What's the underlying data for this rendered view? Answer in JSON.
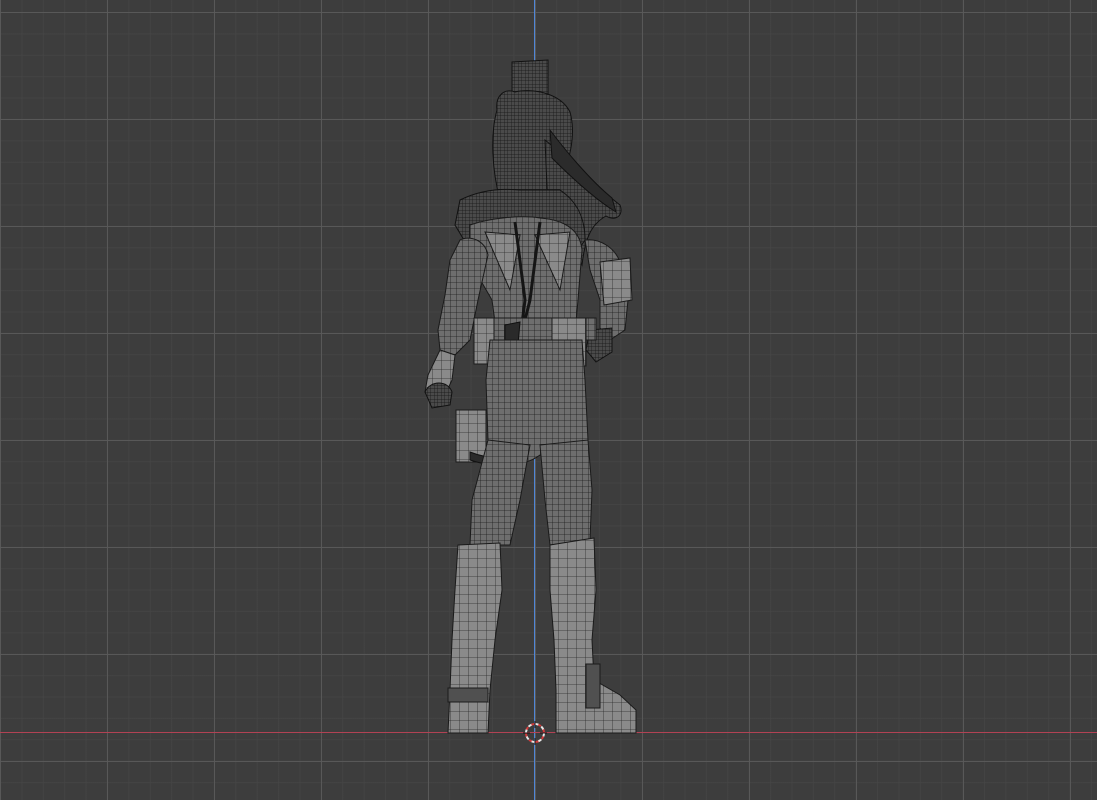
{
  "viewport": {
    "background": "#3d3d3d",
    "grid_major_color": "#5a5a5a",
    "grid_minor_color": "#464646",
    "z_axis_color": "#4f86d8",
    "x_axis_color": "#b24254"
  },
  "model": {
    "shading": "wireframe",
    "view": "back",
    "fill_color": "#6e6e6e",
    "wire_color": "#1c1c1c"
  },
  "cursor_3d": {
    "ring_color_a": "#e8e8e8",
    "ring_color_b": "#d23a3a"
  }
}
